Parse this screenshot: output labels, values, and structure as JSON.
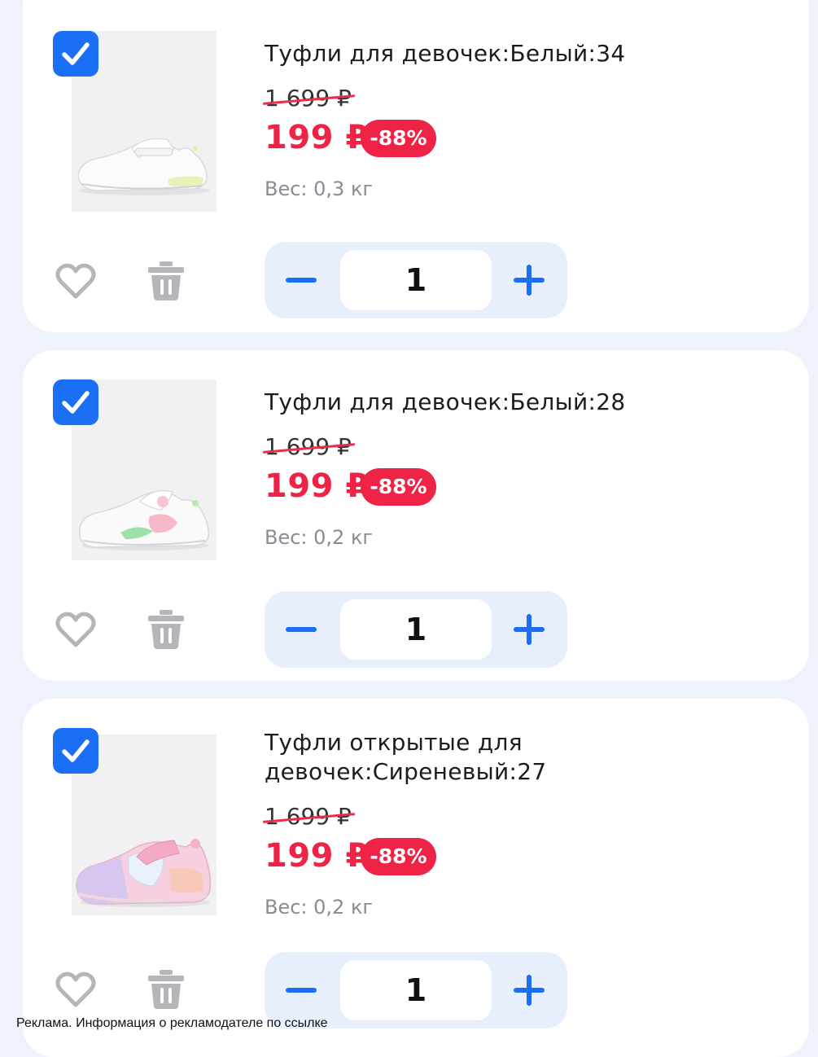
{
  "colors": {
    "accent": "#1a6ff5",
    "price_red": "#ee2346",
    "icon_gray": "#b5b5ba",
    "stepper_bg": "#e6effb",
    "page_bg": "#eef3fb"
  },
  "items": [
    {
      "title": "Туфли для девочек:Белый:34",
      "old_price": "1 699 ₽",
      "new_price": "199 ₽",
      "discount": "-88%",
      "weight": "Вес: 0,3 кг",
      "quantity": "1",
      "checked": true,
      "image": "white-girls-shoe-image"
    },
    {
      "title": "Туфли для девочек:Белый:28",
      "old_price": "1 699 ₽",
      "new_price": "199 ₽",
      "discount": "-88%",
      "weight": "Вес: 0,2 кг",
      "quantity": "1",
      "checked": true,
      "image": "white-girls-shoe-pink-green-image"
    },
    {
      "title": "Туфли открытые для девочек:Сиреневый:27",
      "old_price": "1 699 ₽",
      "new_price": "199 ₽",
      "discount": "-88%",
      "weight": "Вес: 0,2 кг",
      "quantity": "1",
      "checked": true,
      "image": "lilac-girls-shoe-image"
    }
  ],
  "icons": {
    "checkbox": "checkmark-icon",
    "favorite": "heart-icon",
    "delete": "trash-icon",
    "decrease": "minus-icon",
    "increase": "plus-icon"
  },
  "ad_note": "Реклама. Информация о рекламодателе по ссылке"
}
